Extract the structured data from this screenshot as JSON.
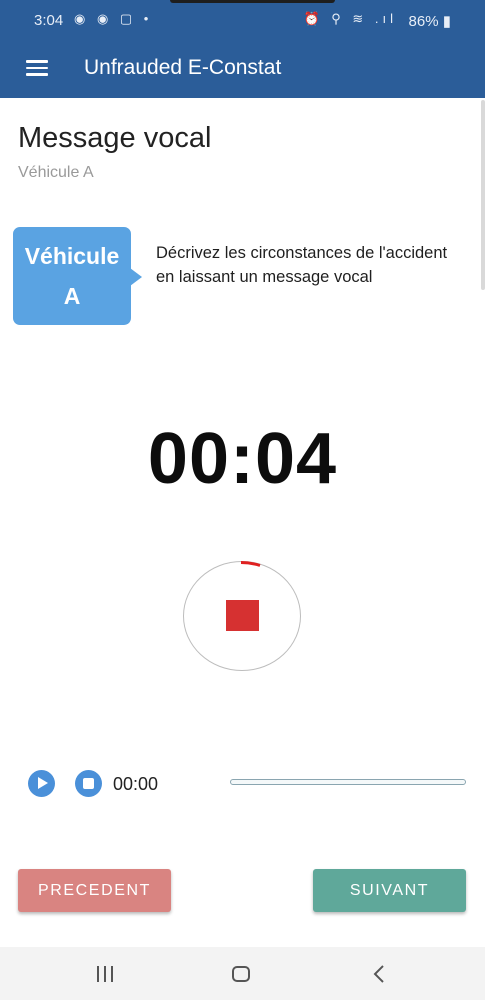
{
  "status_bar": {
    "time": "3:04",
    "left_icons": "◉ ◉ ▢ •",
    "right_icons": "⏰ ⚲ ≋ .ıl",
    "battery": "86%",
    "battery_icon": "battery-charging-icon"
  },
  "app_bar": {
    "title": "Unfrauded E-Constat",
    "menu_icon": "menu-icon"
  },
  "page": {
    "title": "Message vocal",
    "subtitle": "Véhicule A"
  },
  "vehicle_badge": {
    "line1": "Véhicule",
    "line2": "A",
    "color": "#5aa3e2"
  },
  "instructions": "Décrivez les circonstances de l'accident en laissant un message vocal",
  "recorder": {
    "timer": "00:04",
    "stop_icon": "stop-square-icon",
    "stop_color": "#d63131",
    "progress_color": "#e02020"
  },
  "player": {
    "play_icon": "play-icon",
    "stop_icon": "stop-icon",
    "time": "00:00",
    "accent": "#4a90d9"
  },
  "buttons": {
    "previous": "PRECEDENT",
    "next": "SUIVANT",
    "previous_color": "#d98481",
    "next_color": "#5fa89a"
  },
  "nav_bar": {
    "recents_icon": "recents-icon",
    "home_icon": "home-icon",
    "back_icon": "back-icon"
  },
  "colors": {
    "primary": "#2b5d99"
  }
}
